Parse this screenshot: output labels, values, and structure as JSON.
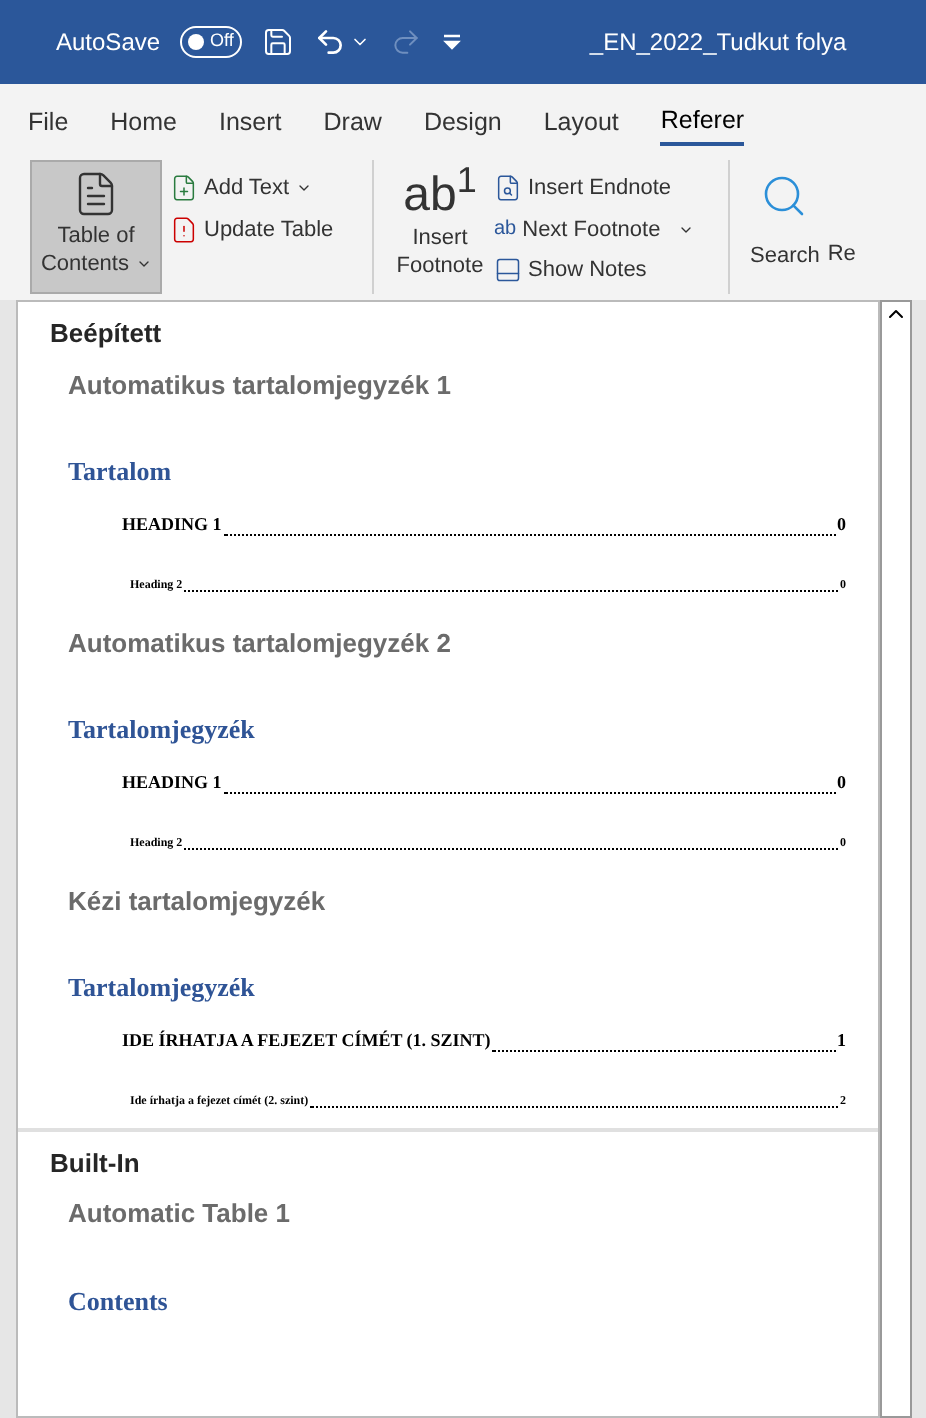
{
  "title_bar": {
    "autosave_label": "AutoSave",
    "autosave_toggle": {
      "label": "Off",
      "on": false
    },
    "redo_disabled": true,
    "title": "_EN_2022_Tudkut folya"
  },
  "tabs": [
    {
      "label": "File",
      "selected": false
    },
    {
      "label": "Home",
      "selected": false
    },
    {
      "label": "Insert",
      "selected": false
    },
    {
      "label": "Draw",
      "selected": false
    },
    {
      "label": "Design",
      "selected": false
    },
    {
      "label": "Layout",
      "selected": false
    },
    {
      "label": "Referer",
      "selected": true
    }
  ],
  "ribbon": {
    "toc_button": {
      "label": "Table of Contents",
      "pressed": true
    },
    "add_text": "Add Text",
    "update_table": "Update Table",
    "footnote_glyph": "ab$^{1}$",
    "insert_footnote": "Insert Footnote",
    "insert_endnote": "Insert Endnote",
    "next_footnote_glyph": "ab",
    "next_footnote": "Next Footnote",
    "show_notes": "Show Notes",
    "search": "Search",
    "cut_button": "Re"
  },
  "gallery": {
    "groups": [
      {
        "heading": "Beépített",
        "entries": [
          {
            "label": "Automatikus tartalomjegyzék 1",
            "preview": {
              "title": "Tartalom",
              "lines": [
                {
                  "kind": "level1",
                  "text": "HEADING 1",
                  "page": "0"
                },
                {
                  "kind": "level2",
                  "text": "Heading 2",
                  "page": "0"
                }
              ]
            }
          },
          {
            "label": "Automatikus tartalomjegyzék 2",
            "preview": {
              "title": "Tartalomjegyzék",
              "lines": [
                {
                  "kind": "level1",
                  "text": "HEADING 1",
                  "page": "0"
                },
                {
                  "kind": "level2",
                  "text": "Heading 2",
                  "page": "0"
                }
              ]
            }
          },
          {
            "label": "Kézi tartalomjegyzék",
            "preview": {
              "title": "Tartalomjegyzék",
              "lines": [
                {
                  "kind": "level1",
                  "text": "IDE ÍRHATJA A FEJEZET CÍMÉT (1. SZINT)",
                  "page": "1"
                },
                {
                  "kind": "level2",
                  "text": "Ide írhatja a fejezet címét (2. szint)",
                  "page": "2"
                }
              ]
            }
          }
        ]
      },
      {
        "heading": "Built-In",
        "entries": [
          {
            "label": "Automatic Table 1",
            "preview": {
              "title": "Contents"
            }
          }
        ]
      }
    ]
  }
}
